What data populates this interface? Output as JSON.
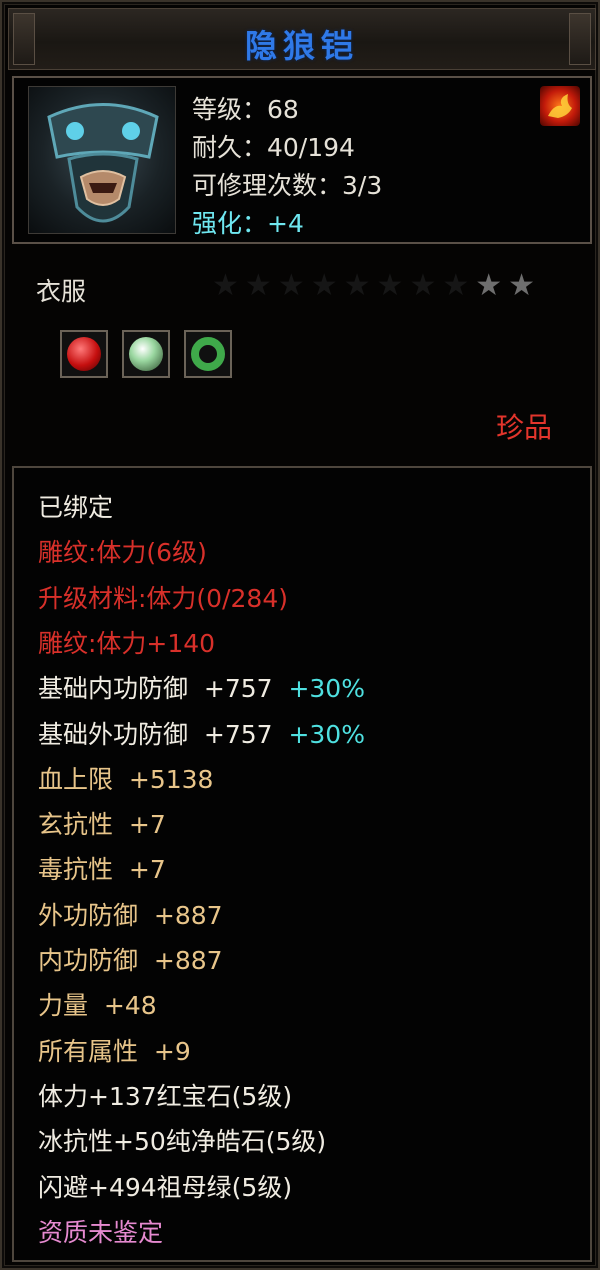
{
  "item": {
    "name": "隐狼铠",
    "level": "等级：68",
    "durability": "耐久：40/194",
    "repairs": "可修理次数：3/3",
    "enhance": "强化：+4",
    "slot": "衣服",
    "stars": {
      "total": 10,
      "lit": 2
    },
    "rarity": "珍品",
    "icons": [
      "armor-portrait-icon",
      "flame-badge-icon",
      "red-gem-icon",
      "white-gem-icon",
      "green-jade-icon"
    ]
  },
  "attributes": [
    {
      "text": "已绑定",
      "extra": "",
      "color": "white"
    },
    {
      "text": "雕纹:体力(6级)",
      "extra": "",
      "color": "red"
    },
    {
      "text": "升级材料:体力(0/284)",
      "extra": "",
      "color": "red"
    },
    {
      "text": "雕纹:体力+140",
      "extra": "",
      "color": "red"
    },
    {
      "text": "基础内功防御  +757",
      "extra": "+30%",
      "color": "white"
    },
    {
      "text": "基础外功防御  +757",
      "extra": "+30%",
      "color": "white"
    },
    {
      "text": "血上限  +5138",
      "extra": "",
      "color": "gold"
    },
    {
      "text": "玄抗性  +7",
      "extra": "",
      "color": "gold"
    },
    {
      "text": "毒抗性  +7",
      "extra": "",
      "color": "gold"
    },
    {
      "text": "外功防御  +887",
      "extra": "",
      "color": "gold"
    },
    {
      "text": "内功防御  +887",
      "extra": "",
      "color": "gold"
    },
    {
      "text": "力量  +48",
      "extra": "",
      "color": "gold"
    },
    {
      "text": "所有属性  +9",
      "extra": "",
      "color": "gold"
    },
    {
      "text": "体力+137红宝石(5级)",
      "extra": "",
      "color": "white"
    },
    {
      "text": "冰抗性+50纯净皓石(5级)",
      "extra": "",
      "color": "white"
    },
    {
      "text": "闪避+494祖母绿(5级)",
      "extra": "",
      "color": "white"
    },
    {
      "text": "资质未鉴定",
      "extra": "",
      "color": "pink"
    }
  ],
  "colors": {
    "title": "#2f79e8",
    "enhance": "#6fe7f0",
    "rarity": "#e3352c",
    "red": "#d8302a",
    "gold": "#e8c58a",
    "white": "#f0ece2",
    "pink": "#e68ad0",
    "cyan": "#4fe0e0"
  }
}
